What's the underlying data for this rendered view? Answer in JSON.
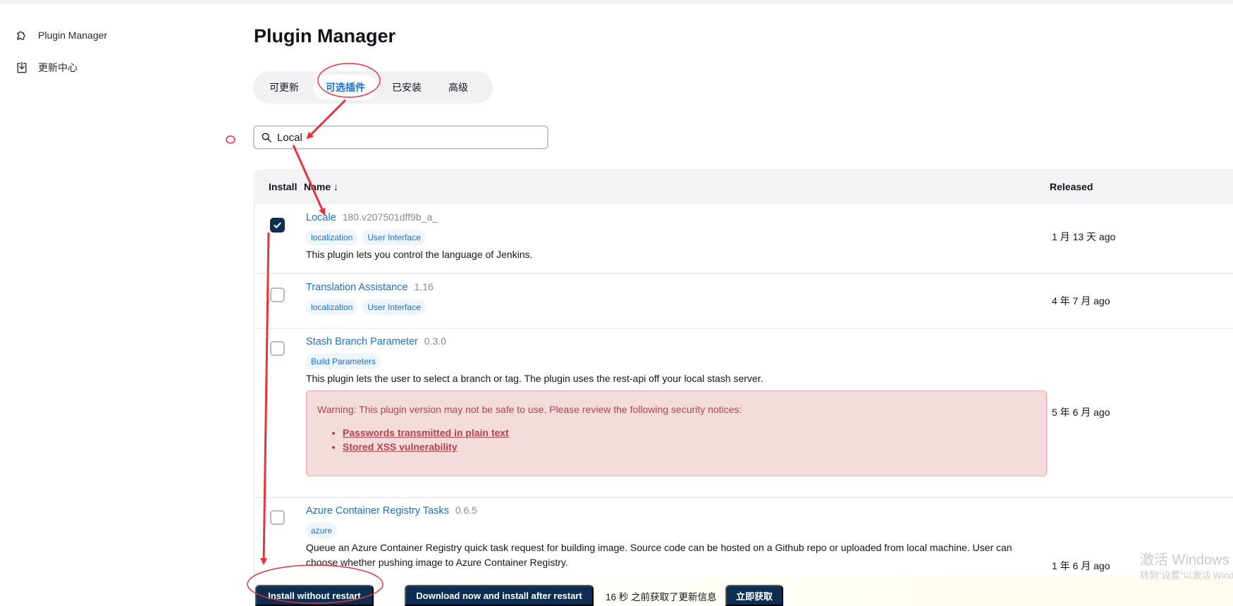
{
  "sidebar": {
    "items": [
      {
        "label": "Plugin Manager",
        "icon": "puzzle-icon"
      },
      {
        "label": "更新中心",
        "icon": "download-icon"
      }
    ]
  },
  "main": {
    "title": "Plugin Manager",
    "tabs": [
      {
        "label": "可更新",
        "active": false
      },
      {
        "label": "可选插件",
        "active": true
      },
      {
        "label": "已安装",
        "active": false
      },
      {
        "label": "高级",
        "active": false
      }
    ],
    "search": {
      "value": "Local",
      "icon": "search-icon"
    }
  },
  "table": {
    "headers": {
      "install": "Install",
      "name": "Name ↓",
      "released": "Released"
    },
    "rows": [
      {
        "checked": true,
        "name": "Locale",
        "version": "180.v207501dff9b_a_",
        "tags": [
          "localization",
          "User Interface"
        ],
        "description": "This plugin lets you control the language of Jenkins.",
        "released": "1 月 13 天 ago"
      },
      {
        "checked": false,
        "name": "Translation Assistance",
        "version": "1.16",
        "tags": [
          "localization",
          "User Interface"
        ],
        "description": "",
        "released": "4 年 7 月 ago"
      },
      {
        "checked": false,
        "name": "Stash Branch Parameter",
        "version": "0.3.0",
        "tags": [
          "Build Parameters"
        ],
        "description": "This plugin lets the user to select a branch or tag. The plugin uses the rest-api off your local stash server.",
        "warning": {
          "text": "Warning: This plugin version may not be safe to use. Please review the following security notices:",
          "links": [
            "Passwords transmitted in plain text",
            "Stored XSS vulnerability"
          ]
        },
        "released": "5 年 6 月 ago"
      },
      {
        "checked": false,
        "name": "Azure Container Registry Tasks",
        "version": "0.6.5",
        "tags": [
          "azure"
        ],
        "description": "Queue an Azure Container Registry quick task request for building image. Source code can be hosted on a Github repo or uploaded from local machine. User can choose whether pushing image to Azure Container Registry.",
        "released": "1 年 6 月 ago"
      }
    ]
  },
  "bottom": {
    "install_now": "Install without restart",
    "install_later": "Download now and install after restart",
    "status": "16 秒 之前获取了更新信息",
    "refresh": "立即获取"
  },
  "watermark": {
    "line1": "激活 Windows",
    "line2": "转到\"设置\"以激活 Windows。"
  },
  "colors": {
    "accent": "#1a6fd0",
    "button": "#0b2e52",
    "warning_bg": "#f4dcdd",
    "warning_text": "#b24349",
    "annotation": "#e8333a"
  }
}
